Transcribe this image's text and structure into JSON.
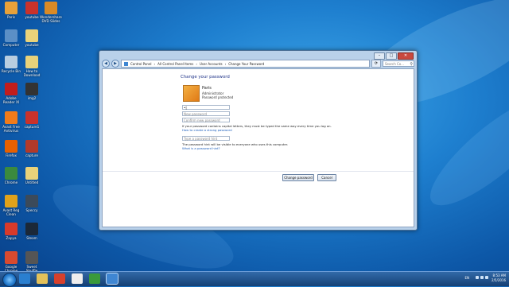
{
  "desktop_icons": [
    {
      "label": "Paris",
      "icon": "user-folder-icon",
      "color": "#e8a13a"
    },
    {
      "label": "youtube",
      "icon": "video-icon",
      "color": "#c9322b"
    },
    {
      "label": "Wondershare DVD Slides",
      "icon": "app-icon",
      "color": "#d98a26"
    },
    {
      "label": "Computer",
      "icon": "computer-icon",
      "color": "#5b8fc6"
    },
    {
      "label": "youtube",
      "icon": "folder-icon",
      "color": "#e9d27a"
    },
    {
      "label": "Recycle Bin",
      "icon": "recycle-bin-icon",
      "color": "#b8cde0"
    },
    {
      "label": "How to Download",
      "icon": "folder-icon",
      "color": "#e9d27a"
    },
    {
      "label": "Adobe Reader XI",
      "icon": "pdf-icon",
      "color": "#c21d1d"
    },
    {
      "label": "img2",
      "icon": "image-icon",
      "color": "#333333"
    },
    {
      "label": "Avast Free Antivirus",
      "icon": "antivirus-icon",
      "color": "#f07b1a"
    },
    {
      "label": "capture1",
      "icon": "video-icon",
      "color": "#c9322b"
    },
    {
      "label": "Firefox",
      "icon": "firefox-icon",
      "color": "#e66000"
    },
    {
      "label": "capture",
      "icon": "video-icon",
      "color": "#b23a2a"
    },
    {
      "label": "Chrome",
      "icon": "chrome-icon",
      "color": "#3b8a3e"
    },
    {
      "label": "Untitled",
      "icon": "document-icon",
      "color": "#e9d27a"
    },
    {
      "label": "Avast Reg Clean",
      "icon": "tool-icon",
      "color": "#e0a21b"
    },
    {
      "label": "Speccy",
      "icon": "speccy-icon",
      "color": "#3b4a5a"
    },
    {
      "label": "Zapya",
      "icon": "zapya-icon",
      "color": "#d83a2a"
    },
    {
      "label": "Steam",
      "icon": "steam-icon",
      "color": "#1b2838"
    },
    {
      "label": "Google Chrome",
      "icon": "chrome-icon",
      "color": "#d84a2f"
    },
    {
      "label": "Sweet Shuffle",
      "icon": "app-icon",
      "color": "#555555"
    }
  ],
  "window": {
    "address": [
      "Control Panel",
      "All Control Panel Items",
      "User Accounts",
      "Change Your Password"
    ],
    "search_placeholder": "Search Co...",
    "title": "Change your password",
    "user": {
      "name": "Paris",
      "role": "Administrator",
      "status": "Password protected"
    },
    "current_password_value": "•|",
    "new_password_placeholder": "New password",
    "confirm_placeholder": "Confirm new password",
    "case_note": "If your password contains capital letters, they must be typed the same way every time you log on.",
    "strong_link": "How to create a strong password",
    "hint_placeholder": "Type a password hint",
    "hint_note": "The password hint will be visible to everyone who uses this computer.",
    "hint_link": "What is a password hint?",
    "change_button": "Change password",
    "cancel_button": "Cancel"
  },
  "taskbar": {
    "items": [
      {
        "name": "ie-icon",
        "color": "#2a7fd0"
      },
      {
        "name": "explorer-icon",
        "color": "#e3c15a"
      },
      {
        "name": "chrome-icon",
        "color": "#d7402c"
      },
      {
        "name": "ccleaner-icon",
        "color": "#eeeeee"
      },
      {
        "name": "camtasia-icon",
        "color": "#3a9a3a"
      },
      {
        "name": "control-panel-icon",
        "color": "#3f86d2"
      }
    ],
    "language": "EN",
    "time": "8:53 AM",
    "date": "2/5/2016"
  }
}
